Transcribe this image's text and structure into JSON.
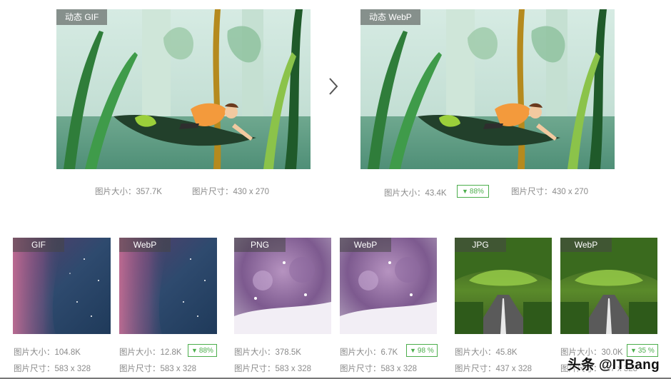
{
  "top": {
    "left": {
      "tag": "动态 GIF",
      "size_label": "图片大小：",
      "size_value": "357.7K",
      "dim_label": "图片尺寸：",
      "dim_value": "430 x 270"
    },
    "right": {
      "tag": "动态 WebP",
      "size_label": "图片大小：",
      "size_value": "43.4K",
      "badge": "88%",
      "dim_label": "图片尺寸：",
      "dim_value": "430 x 270"
    },
    "arrow_icon": "chevron-right-icon"
  },
  "bottom": [
    {
      "tag": "GIF",
      "size_label": "图片大小：",
      "size_value": "104.8K",
      "dim_label": "图片尺寸：",
      "dim_value": "583 x 328",
      "badge": ""
    },
    {
      "tag": "WebP",
      "size_label": "图片大小：",
      "size_value": "12.8K",
      "dim_label": "图片尺寸：",
      "dim_value": "583 x 328",
      "badge": "88%"
    },
    {
      "tag": "PNG",
      "size_label": "图片大小：",
      "size_value": "378.5K",
      "dim_label": "图片尺寸：",
      "dim_value": "583 x 328",
      "badge": ""
    },
    {
      "tag": "WebP",
      "size_label": "图片大小：",
      "size_value": "6.7K",
      "dim_label": "图片尺寸：",
      "dim_value": "583 x 328",
      "badge": "98 %"
    },
    {
      "tag": "JPG",
      "size_label": "图片大小：",
      "size_value": "45.8K",
      "dim_label": "图片尺寸：",
      "dim_value": "437 x 328",
      "badge": ""
    },
    {
      "tag": "WebP",
      "size_label": "图片大小：",
      "size_value": "30.0K",
      "dim_label": "图片尺寸：",
      "dim_value": "437 x 328",
      "badge": "35 %"
    }
  ],
  "watermark": "头条 @ITBang",
  "colors": {
    "badge": "#4cae4c",
    "text": "#8a8a8a"
  }
}
